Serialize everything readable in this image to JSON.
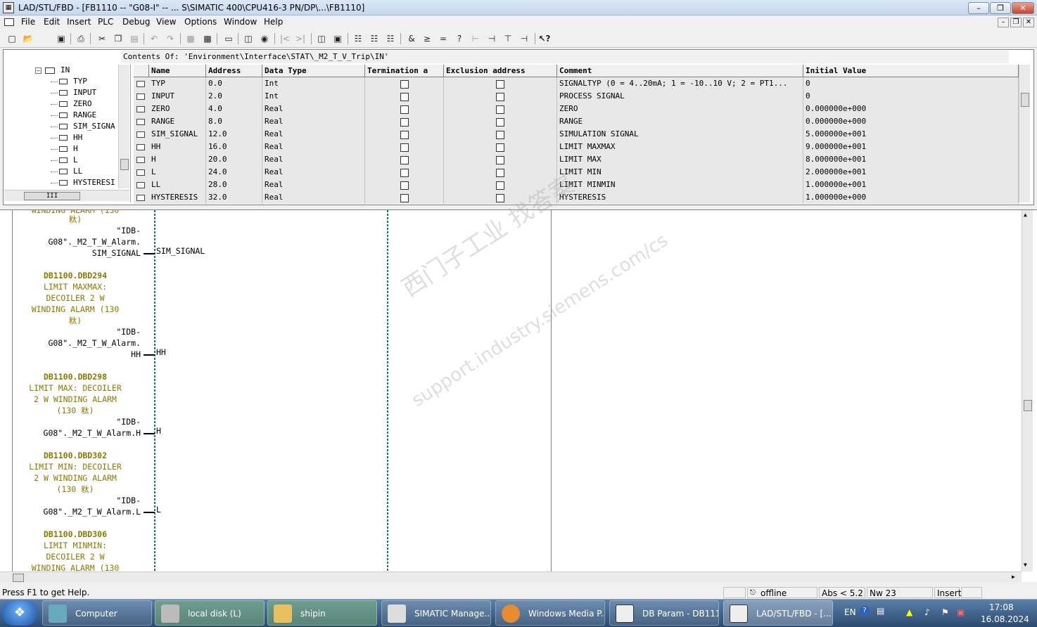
{
  "window": {
    "title": "LAD/STL/FBD  - [FB1110 -- \"G08-I\" -- ...              S\\SIMATIC 400\\CPU416-3 PN/DP\\...\\FB1110]",
    "minimize": "–",
    "restore": "❐",
    "close": "✕"
  },
  "menu": [
    "File",
    "Edit",
    "Insert",
    "PLC",
    "Debug",
    "View",
    "Options",
    "Window",
    "Help"
  ],
  "toolbar_icons": [
    "new-icon",
    "open-icon",
    "save-icon",
    "print-icon",
    "cut-icon",
    "copy-icon",
    "paste-icon",
    "undo-icon",
    "redo-icon",
    "monitor-icon",
    "download-icon",
    "insert-network-icon",
    "compare-icon",
    "diagnose-icon",
    "prev-icon",
    "next-icon",
    "overview-icon",
    "detail-icon",
    "and-box-icon",
    "or-box-icon",
    "assign-box-icon",
    "branch-icon",
    "close-branch-icon",
    "contact-icon",
    "coil-icon",
    "help-icon"
  ],
  "contents_of": "Contents Of: 'Environment\\Interface\\STAT\\_M2_T_V_Trip\\IN'",
  "tree": {
    "root": "IN",
    "items": [
      "TYP",
      "INPUT",
      "ZERO",
      "RANGE",
      "SIM_SIGNA",
      "HH",
      "H",
      "L",
      "LL",
      "HYSTERESI"
    ],
    "scroll_label": "III"
  },
  "table": {
    "headers": [
      "Name",
      "Address",
      "Data Type",
      "Termination a",
      "Exclusion address",
      "Comment",
      "Initial Value"
    ],
    "rows": [
      {
        "name": "TYP",
        "address": "0.0",
        "type": "Int",
        "comment": "SIGNALTYP (0 = 4..20mA; 1 = -10..10 V; 2 = PT1...",
        "initial": "0"
      },
      {
        "name": "INPUT",
        "address": "2.0",
        "type": "Int",
        "comment": "PROCESS SIGNAL",
        "initial": "0"
      },
      {
        "name": "ZERO",
        "address": "4.0",
        "type": "Real",
        "comment": "ZERO",
        "initial": "0.000000e+000"
      },
      {
        "name": "RANGE",
        "address": "8.0",
        "type": "Real",
        "comment": "RANGE",
        "initial": "0.000000e+000"
      },
      {
        "name": "SIM_SIGNAL",
        "address": "12.0",
        "type": "Real",
        "comment": "SIMULATION SIGNAL",
        "initial": "5.000000e+001"
      },
      {
        "name": "HH",
        "address": "16.0",
        "type": "Real",
        "comment": "LIMIT MAXMAX",
        "initial": "9.000000e+001"
      },
      {
        "name": "H",
        "address": "20.0",
        "type": "Real",
        "comment": "LIMIT MAX",
        "initial": "8.000000e+001"
      },
      {
        "name": "L",
        "address": "24.0",
        "type": "Real",
        "comment": "LIMIT MIN",
        "initial": "2.000000e+001"
      },
      {
        "name": "LL",
        "address": "28.0",
        "type": "Real",
        "comment": "LIMIT MINMIN",
        "initial": "1.000000e+001"
      },
      {
        "name": "HYSTERESIS",
        "address": "32.0",
        "type": "Real",
        "comment": "HYSTERESIS",
        "initial": "1.000000e+000"
      }
    ]
  },
  "editor": {
    "top_partial": [
      "WINDING ALARM (130",
      "粏)"
    ],
    "blocks": [
      {
        "ref_lines": [
          "\"IDB-",
          "G08\"._M2_T_W_Alarm.",
          "SIM_SIGNAL"
        ],
        "pin": "SIM_SIGNAL"
      },
      {
        "addr": "DB1100.DBD294",
        "comment": [
          "LIMIT MAXMAX:",
          "DECOILER 2 W",
          "WINDING ALARM (130",
          "粏)"
        ],
        "ref_lines": [
          "\"IDB-",
          "G08\"._M2_T_W_Alarm.",
          "HH"
        ],
        "pin": "HH"
      },
      {
        "addr": "DB1100.DBD298",
        "comment": [
          "LIMIT MAX: DECOILER",
          "2 W WINDING ALARM",
          "(130 粏)"
        ],
        "ref_lines": [
          "\"IDB-",
          "G08\"._M2_T_W_Alarm.H"
        ],
        "pin": "H"
      },
      {
        "addr": "DB1100.DBD302",
        "comment": [
          "LIMIT MIN: DECOILER",
          "2 W WINDING ALARM",
          "(130 粏)"
        ],
        "ref_lines": [
          "\"IDB-",
          "G08\"._M2_T_W_Alarm.L"
        ],
        "pin": "L"
      },
      {
        "addr": "DB1100.DBD306",
        "comment": [
          "LIMIT MINMIN:",
          "DECOILER 2 W",
          "WINDING ALARM (130"
        ]
      }
    ]
  },
  "watermark": [
    "西门子工业  找答案",
    "support.industry.siemens.com/cs"
  ],
  "status": {
    "help": "Press F1 to get Help.",
    "mode": "offline",
    "abs": "Abs < 5.2",
    "nw": "Nw 23",
    "insert": "Insert"
  },
  "taskbar": {
    "tasks": [
      "Computer",
      "local disk (L)",
      "shipin",
      "SIMATIC Manage...",
      "Windows Media P...",
      "DB Param - DB1110",
      "LAD/STL/FBD  - [..."
    ],
    "lang": "EN",
    "time": "17:08",
    "date": "16.08.2024"
  }
}
